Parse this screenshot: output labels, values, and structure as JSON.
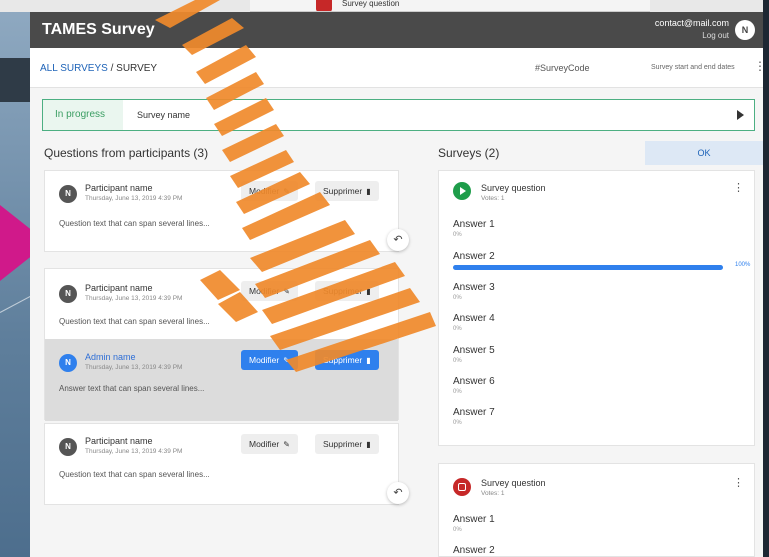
{
  "background": {
    "behind_window_text": "Survey question"
  },
  "app": {
    "title": "TAMES Survey",
    "user_email": "contact@mail.com",
    "logout_label": "Log out",
    "avatar_initial": "N"
  },
  "nav": {
    "breadcrumb_link": "ALL SURVEYS",
    "breadcrumb_separator": " / ",
    "breadcrumb_current": "SURVEY",
    "survey_code": "#SurveyCode",
    "survey_dates": "Survey start and end dates",
    "menu_icon": "more-vertical-icon"
  },
  "status": {
    "label": "In progress",
    "survey_name": "Survey name"
  },
  "questions": {
    "title": "Questions from participants (3)",
    "cards": [
      {
        "author": "Participant name",
        "initial": "N",
        "date": "Thursday, June 13, 2019 4:39 PM",
        "text": "Question text that can span several lines...",
        "modify_label": "Modifier",
        "delete_label": "Supprimer"
      },
      {
        "author": "Participant name",
        "initial": "N",
        "date": "Thursday, June 13, 2019 4:39 PM",
        "text": "Question text that can span several lines...",
        "modify_label": "Modifier",
        "delete_label": "Supprimer",
        "answer": {
          "author": "Admin name",
          "initial": "N",
          "date": "Thursday, June 13, 2019 4:39 PM",
          "text": "Answer text that can span several lines...",
          "modify_label": "Modifier",
          "delete_label": "Supprimer"
        }
      },
      {
        "author": "Participant name",
        "initial": "N",
        "date": "Thursday, June 13, 2019 4:39 PM",
        "text": "Question text that can span several lines...",
        "modify_label": "Modifier",
        "delete_label": "Supprimer"
      }
    ]
  },
  "surveys": {
    "title": "Surveys (2)",
    "ok_label": "OK",
    "cards": [
      {
        "status_icon": "play-icon",
        "status_color": "#1e9d4a",
        "question": "Survey question",
        "votes": "Votes: 1",
        "answers": [
          {
            "label": "Answer 1",
            "pct": "0%",
            "value": 0
          },
          {
            "label": "Answer 2",
            "pct": "100%",
            "value": 1.0
          },
          {
            "label": "Answer 3",
            "pct": "0%",
            "value": 0
          },
          {
            "label": "Answer 4",
            "pct": "0%",
            "value": 0
          },
          {
            "label": "Answer 5",
            "pct": "0%",
            "value": 0
          },
          {
            "label": "Answer 6",
            "pct": "0%",
            "value": 0
          },
          {
            "label": "Answer 7",
            "pct": "0%",
            "value": 0
          }
        ]
      },
      {
        "status_icon": "stop-icon",
        "status_color": "#c62828",
        "question": "Survey question",
        "votes": "Votes: 1",
        "answers": [
          {
            "label": "Answer 1",
            "pct": "0%",
            "value": 0
          },
          {
            "label": "Answer 2",
            "pct": "",
            "value": 0
          }
        ]
      }
    ]
  },
  "colors": {
    "topbar": "#4a4a4a",
    "accent_blue": "#2f80ed",
    "progress_green": "#4caf82",
    "overlay_orange": "#f08a2c",
    "arrow_pink": "#d0198a"
  }
}
